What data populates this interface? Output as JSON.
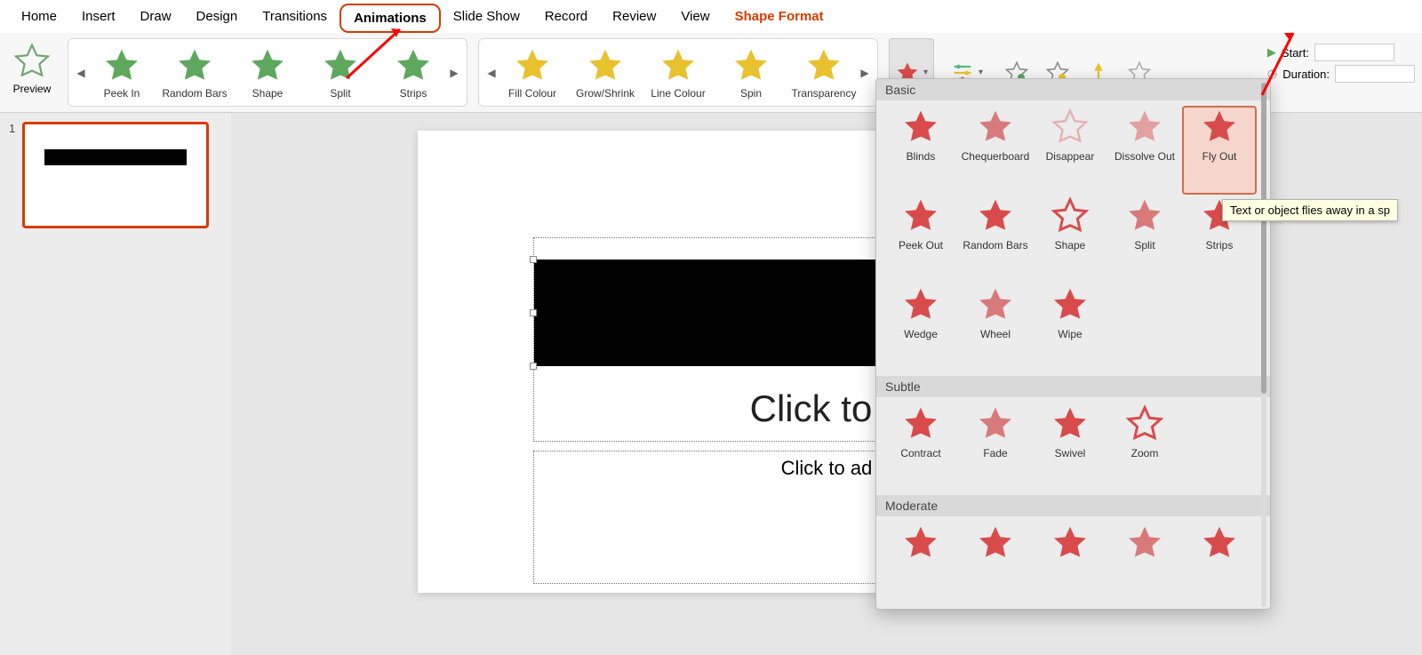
{
  "tabs": {
    "home": "Home",
    "insert": "Insert",
    "draw": "Draw",
    "design": "Design",
    "transitions": "Transitions",
    "animations": "Animations",
    "slideshow": "Slide Show",
    "record": "Record",
    "review": "Review",
    "view": "View",
    "shapeformat": "Shape Format"
  },
  "preview_label": "Preview",
  "entrance_gallery": [
    {
      "key": "peekin",
      "label": "Peek In"
    },
    {
      "key": "randombars",
      "label": "Random Bars"
    },
    {
      "key": "shape",
      "label": "Shape"
    },
    {
      "key": "split",
      "label": "Split"
    },
    {
      "key": "strips",
      "label": "Strips"
    }
  ],
  "emphasis_gallery": [
    {
      "key": "fillcolour",
      "label": "Fill Colour"
    },
    {
      "key": "growshrink",
      "label": "Grow/Shrink"
    },
    {
      "key": "linecolour",
      "label": "Line Colour"
    },
    {
      "key": "spin",
      "label": "Spin"
    },
    {
      "key": "transparency",
      "label": "Transparency"
    }
  ],
  "timing": {
    "start_label": "Start:",
    "duration_label": "Duration:",
    "start_value": "",
    "duration_value": ""
  },
  "slide": {
    "thumb_index": "1",
    "title_placeholder": "Click to a",
    "subtitle_placeholder": "Click to ad"
  },
  "popover": {
    "sections": {
      "basic": "Basic",
      "subtle": "Subtle",
      "moderate": "Moderate"
    },
    "basic": [
      "Blinds",
      "Chequerboard",
      "Disappear",
      "Dissolve Out",
      "Fly Out",
      "Peek Out",
      "Random Bars",
      "Shape",
      "Split",
      "Strips",
      "Wedge",
      "Wheel",
      "Wipe"
    ],
    "subtle": [
      "Contract",
      "Fade",
      "Swivel",
      "Zoom"
    ],
    "moderate": [
      "",
      "",
      "",
      "",
      ""
    ],
    "selected": "Fly Out"
  },
  "tooltip_text": "Text or object flies away in a sp"
}
